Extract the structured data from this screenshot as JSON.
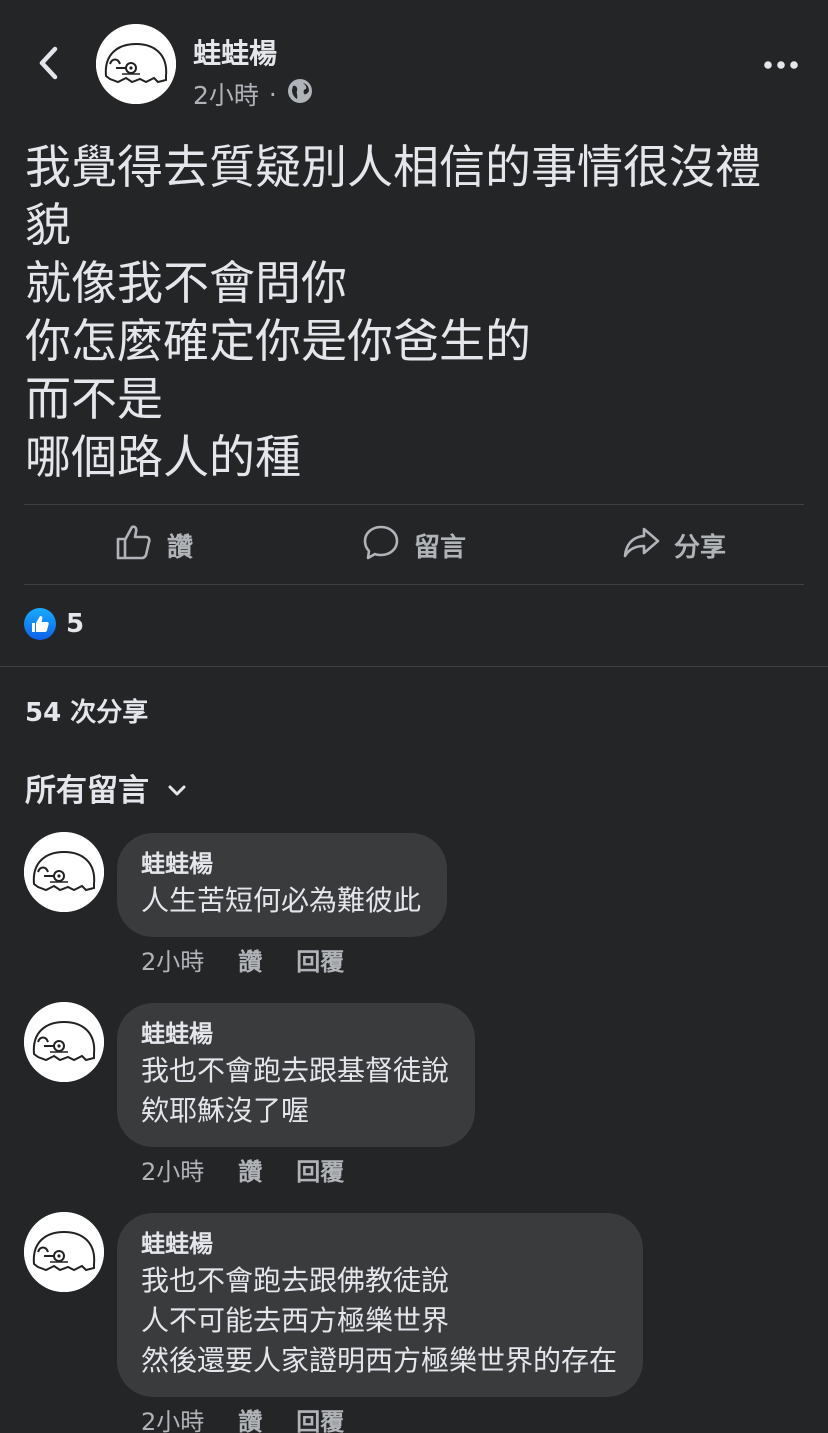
{
  "header": {
    "author": "蛙蛙楊",
    "time": "2小時",
    "separator": "·",
    "back_icon": "chevron-left-icon",
    "privacy_icon": "globe-icon",
    "more_icon": "more-horizontal-icon"
  },
  "post": {
    "lines": [
      "我覺得去質疑別人相信的事情很沒禮",
      "貌",
      "就像我不會問你",
      "你怎麼確定你是你爸生的",
      "而不是",
      "哪個路人的種"
    ]
  },
  "actions": {
    "like": "讚",
    "comment": "留言",
    "share": "分享"
  },
  "reactions": {
    "count": "5",
    "icon": "thumbs-up-icon",
    "color": "#1877f2"
  },
  "shares_text": "54 次分享",
  "comments_header": "所有留言",
  "comments": [
    {
      "name": "蛙蛙楊",
      "lines": [
        "人生苦短何必為難彼此"
      ],
      "time": "2小時",
      "like": "讚",
      "reply": "回覆"
    },
    {
      "name": "蛙蛙楊",
      "lines": [
        "我也不會跑去跟基督徒說",
        "欸耶穌沒了喔"
      ],
      "time": "2小時",
      "like": "讚",
      "reply": "回覆"
    },
    {
      "name": "蛙蛙楊",
      "lines": [
        "我也不會跑去跟佛教徒說",
        "人不可能去西方極樂世界",
        "然後還要人家證明西方極樂世界的存在"
      ],
      "time": "2小時",
      "like": "讚",
      "reply": "回覆"
    }
  ],
  "colors": {
    "background": "#242526",
    "bubble": "#3a3b3c",
    "primary_text": "#e4e6eb",
    "secondary_text": "#b0b3b8"
  }
}
